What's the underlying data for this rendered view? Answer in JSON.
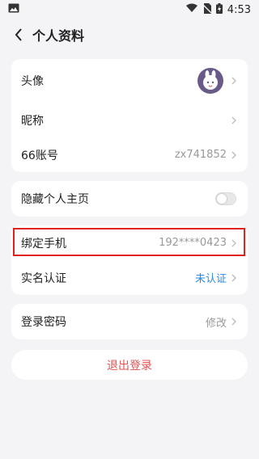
{
  "status": {
    "time": "4:53"
  },
  "nav": {
    "title": "个人资料"
  },
  "profile": {
    "avatar_label": "头像",
    "nickname_label": "昵称",
    "account_label": "66账号",
    "account_value": "zx741852"
  },
  "privacy": {
    "hide_label": "隐藏个人主页",
    "hide_on": false
  },
  "security": {
    "phone_label": "绑定手机",
    "phone_value": "192****0423",
    "realname_label": "实名认证",
    "realname_value": "未认证",
    "password_label": "登录密码",
    "password_value": "修改"
  },
  "logout": {
    "label": "退出登录"
  },
  "colors": {
    "accent_blue": "#2a8be8",
    "logout_red": "#e35353",
    "highlight_red": "#e0221f"
  }
}
